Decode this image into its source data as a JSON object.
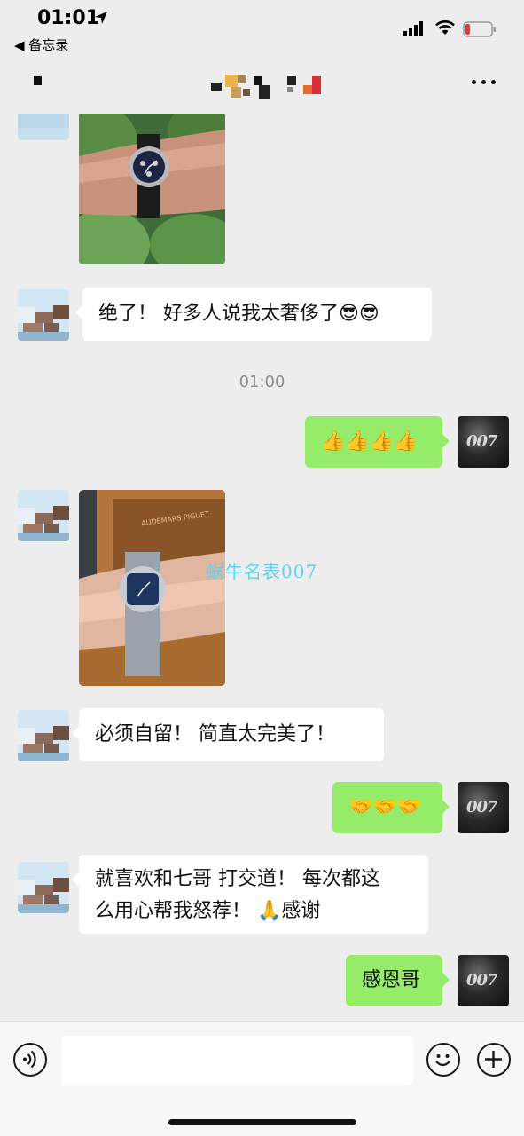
{
  "status_bar": {
    "time": "01:01",
    "back_app": "◀ 备忘录"
  },
  "nav": {
    "more_label": "more"
  },
  "messages": {
    "m1_text": "绝了！ 好多人说我太奢侈了😎😎",
    "timestamp": "01:00",
    "m2_text": "👍👍👍👍",
    "m3_text": "必须自留！ 简直太完美了！",
    "m4_text": "🤝🤝🤝",
    "m5_line1": "就喜欢和七哥 打交道！ 每次都这",
    "m5_line2": "么用心帮我怒荐！ 🙏感谢",
    "m6_text": "感恩哥"
  },
  "photo2_brand": "AUDEMARS PIGUET",
  "watermark": "蜗牛名表007",
  "avatar_me_logo": "007",
  "colors": {
    "background": "#ededed",
    "bubble_self": "#95ec69",
    "bubble_other": "#ffffff",
    "watermark": "#5fd3f3"
  },
  "icons": [
    "location-arrow-icon",
    "signal-icon",
    "wifi-icon",
    "battery-icon",
    "more-icon",
    "voice-icon",
    "emoji-icon",
    "plus-icon"
  ]
}
